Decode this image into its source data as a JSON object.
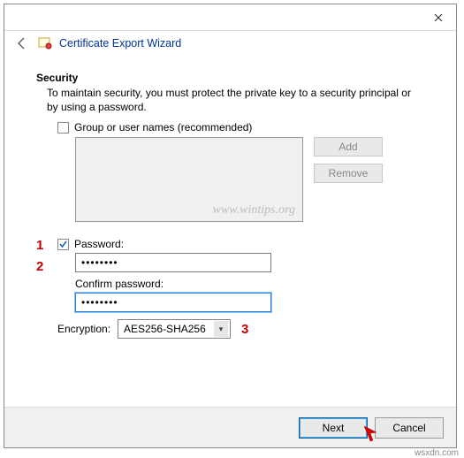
{
  "window": {
    "title": "Certificate Export Wizard"
  },
  "section": {
    "heading": "Security",
    "description": "To maintain security, you must protect the private key to a security principal or by using a password."
  },
  "group": {
    "checkbox_label": "Group or user names (recommended)",
    "checked": false,
    "add_button": "Add",
    "remove_button": "Remove"
  },
  "password": {
    "checkbox_label": "Password:",
    "checked": true,
    "value": "••••••••",
    "confirm_label": "Confirm password:",
    "confirm_value": "••••••••"
  },
  "encryption": {
    "label": "Encryption:",
    "selected": "AES256-SHA256"
  },
  "footer": {
    "next": "Next",
    "cancel": "Cancel"
  },
  "annotations": {
    "a1": "1",
    "a2": "2",
    "a3": "3"
  },
  "watermark": "www.wintips.org",
  "attribution": "wsxdn.com"
}
